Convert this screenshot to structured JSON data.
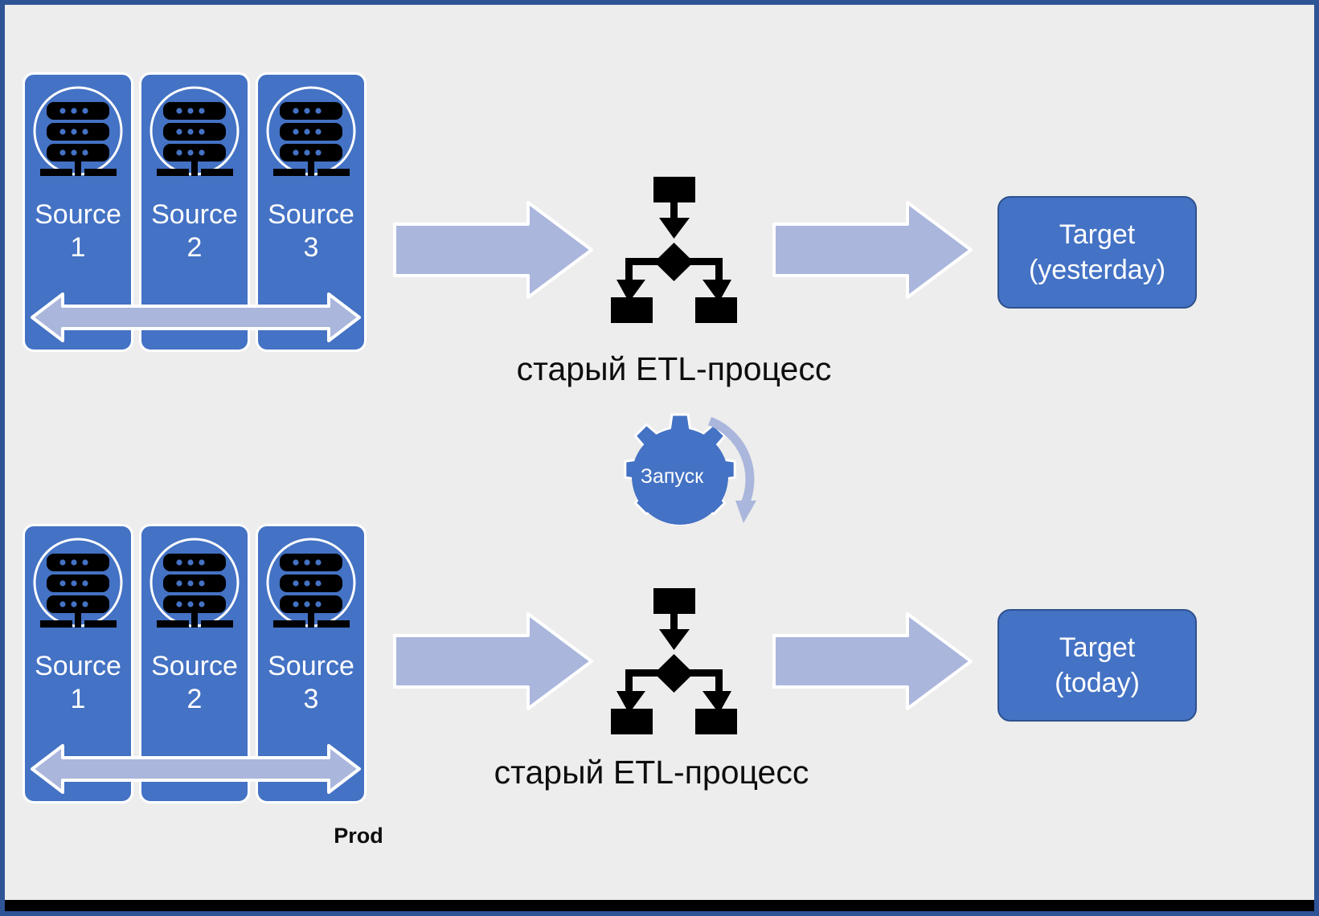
{
  "slide": {
    "background_color": "#ededed",
    "border_color": "#2f5496",
    "accent_blue": "#4472c4",
    "arrow_blue": "#aab6dc",
    "footer_label": "Prod"
  },
  "rows": [
    {
      "id": "yesterday-row",
      "sources": [
        {
          "icon": "server-icon",
          "label": "Source\n1"
        },
        {
          "icon": "server-icon",
          "label": "Source\n2"
        },
        {
          "icon": "server-icon",
          "label": "Source\n3"
        }
      ],
      "span_arrow": "double-headed-arrow",
      "in_arrow": "right-block-arrow",
      "process": {
        "icon": "etl-flowchart-icon",
        "label": "старый ETL-процесс"
      },
      "out_arrow": "right-block-arrow",
      "target": {
        "label": "Target\n(yesterday)"
      }
    },
    {
      "id": "today-row",
      "sources": [
        {
          "icon": "server-icon",
          "label": "Source\n1"
        },
        {
          "icon": "server-icon",
          "label": "Source\n2"
        },
        {
          "icon": "server-icon",
          "label": "Source\n3"
        }
      ],
      "span_arrow": "double-headed-arrow",
      "in_arrow": "right-block-arrow",
      "process": {
        "icon": "etl-flowchart-icon",
        "label": "старый ETL-процесс"
      },
      "out_arrow": "right-block-arrow",
      "target": {
        "label": "Target\n(today)"
      }
    }
  ],
  "gear": {
    "label": "Запуск",
    "icon": "gear-icon",
    "loop_arrow": "circular-arrow-icon"
  }
}
